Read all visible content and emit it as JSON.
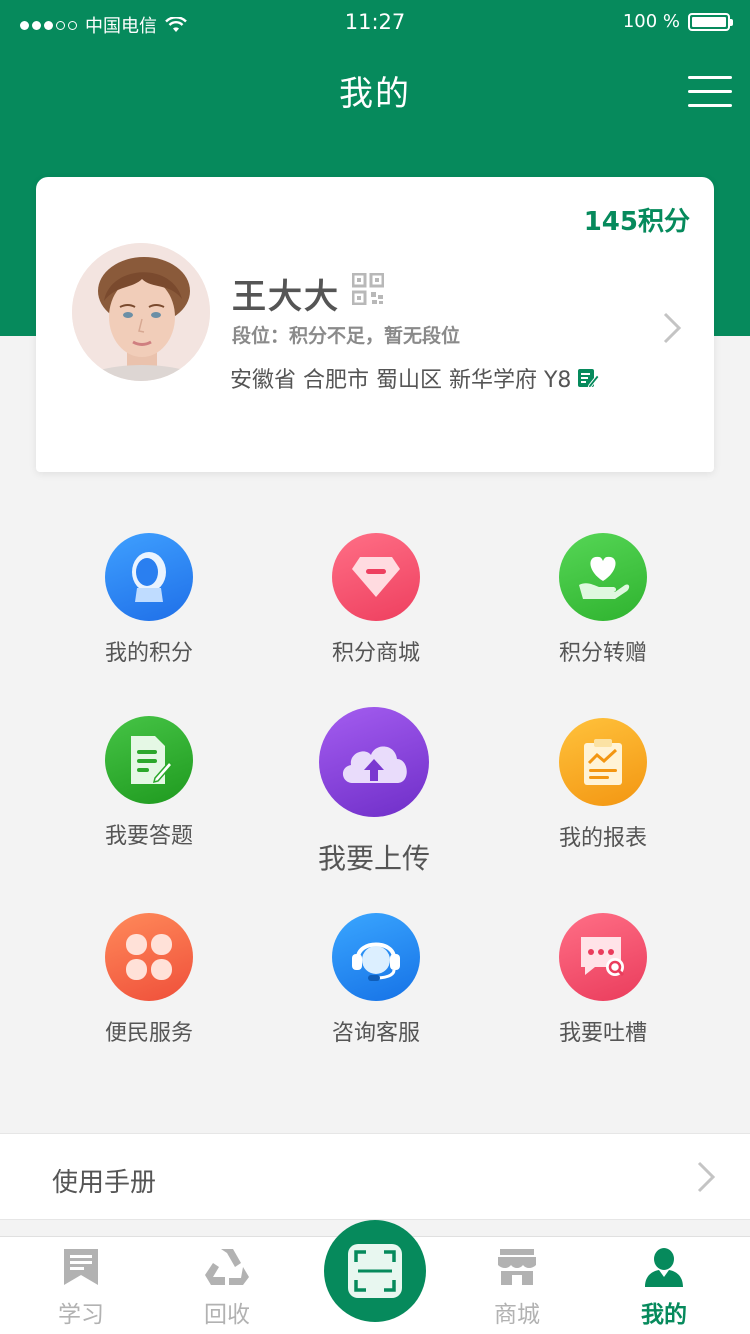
{
  "status_bar": {
    "carrier": "中国电信",
    "time": "11:27",
    "battery": "100 %"
  },
  "nav": {
    "title": "我的",
    "menu_icon": "hamburger-menu-icon"
  },
  "profile": {
    "points": "145积分",
    "name": "王大大",
    "rank": "段位：积分不足，暂无段位",
    "address": "安徽省 合肥市 蜀山区 新华学府 Y8",
    "qr_icon": "qr-code-icon",
    "edit_icon": "edit-icon"
  },
  "grid": {
    "items": [
      {
        "label": "我的积分",
        "icon": "user-profile-icon",
        "color": "#2a7ff0"
      },
      {
        "label": "积分商城",
        "icon": "diamond-icon",
        "color": "#f2506c"
      },
      {
        "label": "积分转赠",
        "icon": "heart-hand-icon",
        "color": "#3cc43c"
      },
      {
        "label": "我要答题",
        "icon": "document-edit-icon",
        "color": "#2ca82c"
      },
      {
        "label": "我要上传",
        "icon": "cloud-upload-icon",
        "color": "#8a45d8"
      },
      {
        "label": "我的报表",
        "icon": "report-chart-icon",
        "color": "#f5a623"
      },
      {
        "label": "便民服务",
        "icon": "clover-icon",
        "color": "#f25a3c"
      },
      {
        "label": "咨询客服",
        "icon": "headset-icon",
        "color": "#1e86f0"
      },
      {
        "label": "我要吐槽",
        "icon": "chat-search-icon",
        "color": "#f2506c"
      }
    ]
  },
  "manual": {
    "label": "使用手册"
  },
  "tab_bar": {
    "tabs": [
      {
        "label": "学习",
        "icon": "bookmark-icon"
      },
      {
        "label": "回收",
        "icon": "recycle-icon"
      },
      {
        "label": "商城",
        "icon": "store-icon"
      },
      {
        "label": "我的",
        "icon": "person-icon"
      }
    ],
    "center_icon": "scan-icon",
    "active_color": "#068a5c",
    "inactive_color": "#b2b2b2"
  }
}
